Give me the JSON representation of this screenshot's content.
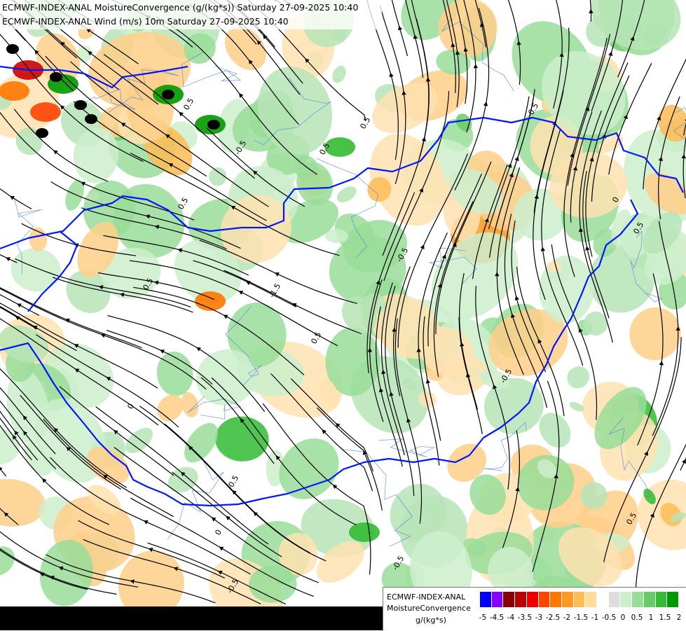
{
  "titles": {
    "line1": "ECMWF-INDEX-ANAL MoistureConvergence (g/(kg*s)) Saturday 27-09-2025 10:40",
    "line2": "ECMWF-INDEX-ANAL Wind (m/s) 10m Saturday 27-09-2025 10:40"
  },
  "legend": {
    "model": "ECMWF-INDEX-ANAL",
    "parameter": "MoistureConvergence",
    "unit": "g/(kg*s)",
    "colors": [
      "#0000ff",
      "#8800ff",
      "#8b0000",
      "#bb0000",
      "#ee0000",
      "#ff4400",
      "#ff7700",
      "#ff9922",
      "#ffbb55",
      "#ffdd99",
      "#ffffff",
      "#dddddd",
      "#cceecc",
      "#99dd99",
      "#66cc66",
      "#33bb33",
      "#009900"
    ],
    "ticks": [
      "-5",
      "-4.5",
      "-4",
      "-3.5",
      "-3",
      "-2.5",
      "-2",
      "-1.5",
      "-1",
      "-0.5",
      "0",
      "0.5",
      "1",
      "1.5",
      "2"
    ]
  },
  "contour_labels": [
    "0.5",
    "0.5",
    "-0.5",
    "-1.5",
    "0.5",
    "-0.5",
    "0",
    "0.5",
    "0.5",
    "-0.5",
    "0",
    "0.5",
    "-0.5",
    "0.5",
    "-0.5",
    "0.5",
    "0.5",
    "-0.5",
    "0"
  ]
}
